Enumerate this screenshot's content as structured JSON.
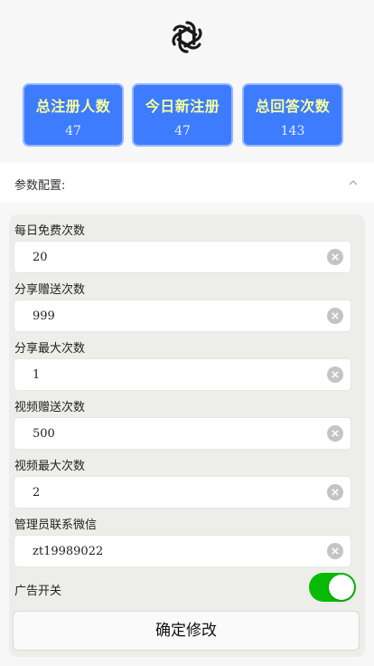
{
  "stats": [
    {
      "title": "总注册人数",
      "value": "47"
    },
    {
      "title": "今日新注册",
      "value": "47"
    },
    {
      "title": "总回答次数",
      "value": "143"
    }
  ],
  "section": {
    "title": "参数配置:",
    "icon": "chevron-up-icon"
  },
  "fields": [
    {
      "label": "每日免费次数",
      "value": "20"
    },
    {
      "label": "分享赠送次数",
      "value": "999"
    },
    {
      "label": "分享最大次数",
      "value": "1"
    },
    {
      "label": "视频赠送次数",
      "value": "500"
    },
    {
      "label": "视频最大次数",
      "value": "2"
    },
    {
      "label": "管理员联系微信",
      "value": "zt19989022"
    }
  ],
  "ad_switch": {
    "label": "广告开关",
    "on": true
  },
  "submit": {
    "label": "确定修改"
  },
  "colors": {
    "accent": "#3d7bff",
    "stat_title": "#f6ff9a",
    "switch_on": "#09bb07"
  }
}
